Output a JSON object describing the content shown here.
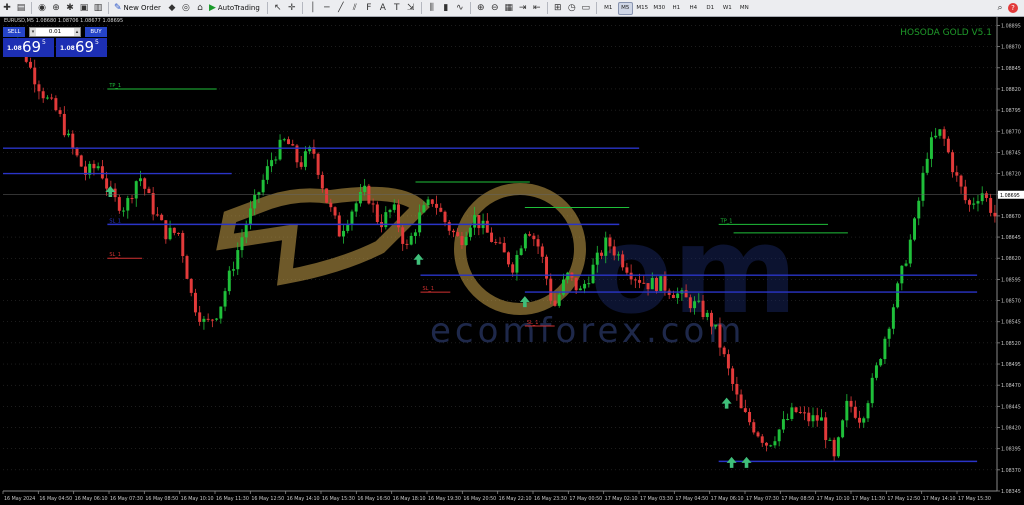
{
  "toolbar": {
    "items": [
      {
        "type": "icon",
        "name": "new-chart-icon",
        "glyph": "✚"
      },
      {
        "type": "icon",
        "name": "profiles-icon",
        "glyph": "▤"
      },
      {
        "type": "sep"
      },
      {
        "type": "icon",
        "name": "market-watch-icon",
        "glyph": "◉"
      },
      {
        "type": "icon",
        "name": "data-window-icon",
        "glyph": "⊕"
      },
      {
        "type": "icon",
        "name": "navigator-icon",
        "glyph": "✱"
      },
      {
        "type": "icon",
        "name": "terminal-icon",
        "glyph": "▣"
      },
      {
        "type": "icon",
        "name": "strategy-tester-icon",
        "glyph": "▥"
      },
      {
        "type": "sep"
      },
      {
        "type": "button",
        "name": "new-order-button",
        "icon": "✎",
        "label": "New Order"
      },
      {
        "type": "icon",
        "name": "metaeditor-icon",
        "glyph": "◆"
      },
      {
        "type": "icon",
        "name": "signals-icon",
        "glyph": "◎"
      },
      {
        "type": "icon",
        "name": "vps-icon",
        "glyph": "⌂"
      },
      {
        "type": "button",
        "name": "auto-trading-button",
        "icon": "▶",
        "label": "AutoTrading"
      },
      {
        "type": "sep"
      },
      {
        "type": "icon",
        "name": "cursor-icon",
        "glyph": "↖"
      },
      {
        "type": "icon",
        "name": "crosshair-icon",
        "glyph": "✛"
      },
      {
        "type": "sep"
      },
      {
        "type": "icon",
        "name": "vertical-line-icon",
        "glyph": "│"
      },
      {
        "type": "icon",
        "name": "horizontal-line-icon",
        "glyph": "─"
      },
      {
        "type": "icon",
        "name": "trendline-icon",
        "glyph": "╱"
      },
      {
        "type": "icon",
        "name": "equidistant-channel-icon",
        "glyph": "⫽"
      },
      {
        "type": "icon",
        "name": "fibonacci-icon",
        "glyph": "F"
      },
      {
        "type": "icon",
        "name": "text-icon",
        "glyph": "A"
      },
      {
        "type": "icon",
        "name": "text-label-icon",
        "glyph": "T"
      },
      {
        "type": "icon",
        "name": "arrows-icon",
        "glyph": "⇲"
      },
      {
        "type": "sep"
      },
      {
        "type": "icon",
        "name": "bar-chart-icon",
        "glyph": "⫼"
      },
      {
        "type": "icon",
        "name": "candlestick-icon",
        "glyph": "▮"
      },
      {
        "type": "icon",
        "name": "line-chart-icon",
        "glyph": "∿"
      },
      {
        "type": "sep"
      },
      {
        "type": "icon",
        "name": "zoom-in-icon",
        "glyph": "⊕"
      },
      {
        "type": "icon",
        "name": "zoom-out-icon",
        "glyph": "⊖"
      },
      {
        "type": "icon",
        "name": "tile-windows-icon",
        "glyph": "▦"
      },
      {
        "type": "icon",
        "name": "chart-shift-icon",
        "glyph": "⇥"
      },
      {
        "type": "icon",
        "name": "auto-scroll-icon",
        "glyph": "⇤"
      },
      {
        "type": "sep"
      },
      {
        "type": "icon",
        "name": "indicators-icon",
        "glyph": "⊞"
      },
      {
        "type": "icon",
        "name": "periods-icon",
        "glyph": "◷"
      },
      {
        "type": "icon",
        "name": "templates-icon",
        "glyph": "▭"
      },
      {
        "type": "sep"
      },
      {
        "type": "tf",
        "label": "M1"
      },
      {
        "type": "tf",
        "label": "M5",
        "active": true
      },
      {
        "type": "tf",
        "label": "M15"
      },
      {
        "type": "tf",
        "label": "M30"
      },
      {
        "type": "tf",
        "label": "H1"
      },
      {
        "type": "tf",
        "label": "H4"
      },
      {
        "type": "tf",
        "label": "D1"
      },
      {
        "type": "tf",
        "label": "W1"
      },
      {
        "type": "tf",
        "label": "MN"
      }
    ],
    "search_icon": "search-icon",
    "search_glyph": "⌕",
    "help_icon": "help-icon",
    "help_glyph": "?"
  },
  "chart_window": {
    "symbol_title": "EURUSD,M5  1.08680 1.08706 1.08677 1.08695",
    "ea_name": "HOSODA GOLD V5.1",
    "watermark_text": "ecomforex.com"
  },
  "one_click": {
    "sell_label": "SELL",
    "buy_label": "BUY",
    "lot_value": "0.01",
    "lot_down": "▾",
    "lot_up": "▴",
    "sell_price_big": "1.08",
    "sell_price_main": "69",
    "sell_price_sup": "5",
    "buy_price_big": "1.08",
    "buy_price_main": "69",
    "buy_price_sup": "5"
  },
  "colors": {
    "background": "#000000",
    "bull": "#1fbf3a",
    "bear": "#e23a3a",
    "blue_line": "#2a34c8",
    "green_line": "#1fbf3a",
    "red_label": "#d23232",
    "axis_text": "#c8c8c8",
    "grid": "#3a3a3a",
    "ea_name": "#1f9a2a",
    "watermark": "#c9a24a"
  },
  "chart_data": {
    "type": "candlestick",
    "symbol": "EURUSD",
    "timeframe": "M5",
    "ylim": [
      1.08345,
      1.08905
    ],
    "y_ticks": [
      "1.08895",
      "1.08870",
      "1.08845",
      "1.08820",
      "1.08795",
      "1.08770",
      "1.08745",
      "1.08720",
      "1.08695",
      "1.08670",
      "1.08645",
      "1.08620",
      "1.08595",
      "1.08570",
      "1.08545",
      "1.08520",
      "1.08495",
      "1.08470",
      "1.08445",
      "1.08420",
      "1.08395",
      "1.08370",
      "1.08345"
    ],
    "current_price": "1.08695",
    "x_ticks": [
      "16 May 2024",
      "16 May 04:50",
      "16 May 06:10",
      "16 May 07:30",
      "16 May 08:50",
      "16 May 10:10",
      "16 May 11:30",
      "16 May 12:50",
      "16 May 14:10",
      "16 May 15:30",
      "16 May 16:50",
      "16 May 18:10",
      "16 May 19:30",
      "16 May 20:50",
      "16 May 22:10",
      "16 May 23:30",
      "17 May 00:50",
      "17 May 02:10",
      "17 May 03:30",
      "17 May 04:50",
      "17 May 06:10",
      "17 May 07:30",
      "17 May 08:50",
      "17 May 10:10",
      "17 May 11:30",
      "17 May 12:50",
      "17 May 14:10",
      "17 May 15:30"
    ],
    "close_path": [
      1.0887,
      1.0888,
      1.0884,
      1.0881,
      1.0879,
      1.0875,
      1.0872,
      1.0873,
      1.0869,
      1.0868,
      1.0872,
      1.0868,
      1.0865,
      1.0865,
      1.0857,
      1.0854,
      1.0856,
      1.0861,
      1.0866,
      1.087,
      1.0874,
      1.0876,
      1.0873,
      1.0875,
      1.0869,
      1.0865,
      1.0868,
      1.087,
      1.0866,
      1.0868,
      1.0863,
      1.0867,
      1.0869,
      1.0866,
      1.0864,
      1.0867,
      1.0865,
      1.0863,
      1.0861,
      1.0866,
      1.0863,
      1.0856,
      1.086,
      1.0858,
      1.0861,
      1.0864,
      1.0862,
      1.086,
      1.0859,
      1.0859,
      1.0858,
      1.0857,
      1.0856,
      1.0854,
      1.0849,
      1.0844,
      1.0842,
      1.084,
      1.0842,
      1.0844,
      1.0843,
      1.0843,
      1.0838,
      1.0845,
      1.0843,
      1.0848,
      1.0854,
      1.086,
      1.0866,
      1.0875,
      1.0877,
      1.0872,
      1.0868,
      1.087,
      1.0867
    ],
    "levels": [
      {
        "kind": "blue",
        "price": 1.0875,
        "from": 0.0,
        "to": 0.64
      },
      {
        "kind": "blue",
        "price": 1.0872,
        "from": 0.0,
        "to": 0.23
      },
      {
        "kind": "blue",
        "price": 1.0866,
        "from": 0.105,
        "to": 0.62
      },
      {
        "kind": "blue",
        "price": 1.086,
        "from": 0.42,
        "to": 0.98
      },
      {
        "kind": "blue",
        "price": 1.0858,
        "from": 0.525,
        "to": 0.98
      },
      {
        "kind": "blue",
        "price": 1.0838,
        "from": 0.72,
        "to": 0.98
      },
      {
        "kind": "green",
        "price": 1.0882,
        "from": 0.105,
        "to": 0.215
      },
      {
        "kind": "green",
        "price": 1.0871,
        "from": 0.415,
        "to": 0.53
      },
      {
        "kind": "green",
        "price": 1.0868,
        "from": 0.525,
        "to": 0.63
      },
      {
        "kind": "green",
        "price": 1.0866,
        "from": 0.72,
        "to": 0.83
      },
      {
        "kind": "green",
        "price": 1.0865,
        "from": 0.735,
        "to": 0.85
      },
      {
        "kind": "red",
        "price": 1.0862,
        "from": 0.105,
        "to": 0.14
      },
      {
        "kind": "red",
        "price": 1.0858,
        "from": 0.42,
        "to": 0.45
      },
      {
        "kind": "red",
        "price": 1.0854,
        "from": 0.525,
        "to": 0.555
      }
    ],
    "level_labels": [
      {
        "text": "TP_1",
        "price": 1.0882,
        "at": 0.107,
        "kind": "green"
      },
      {
        "text": "TP_1",
        "price": 1.0866,
        "at": 0.722,
        "kind": "green"
      },
      {
        "text": "SL_1",
        "price": 1.0866,
        "at": 0.107,
        "kind": "blue"
      },
      {
        "text": "SL_1",
        "price": 1.0862,
        "at": 0.107,
        "kind": "red"
      },
      {
        "text": "SL_1",
        "price": 1.0858,
        "at": 0.422,
        "kind": "red"
      },
      {
        "text": "SL_1",
        "price": 1.0854,
        "at": 0.527,
        "kind": "red"
      }
    ],
    "buy_arrows": [
      {
        "price": 1.0871,
        "at": 0.108
      },
      {
        "price": 1.0863,
        "at": 0.418
      },
      {
        "price": 1.0858,
        "at": 0.525
      },
      {
        "price": 1.0846,
        "at": 0.728
      },
      {
        "price": 1.0839,
        "at": 0.733
      },
      {
        "price": 1.0839,
        "at": 0.748
      }
    ]
  }
}
